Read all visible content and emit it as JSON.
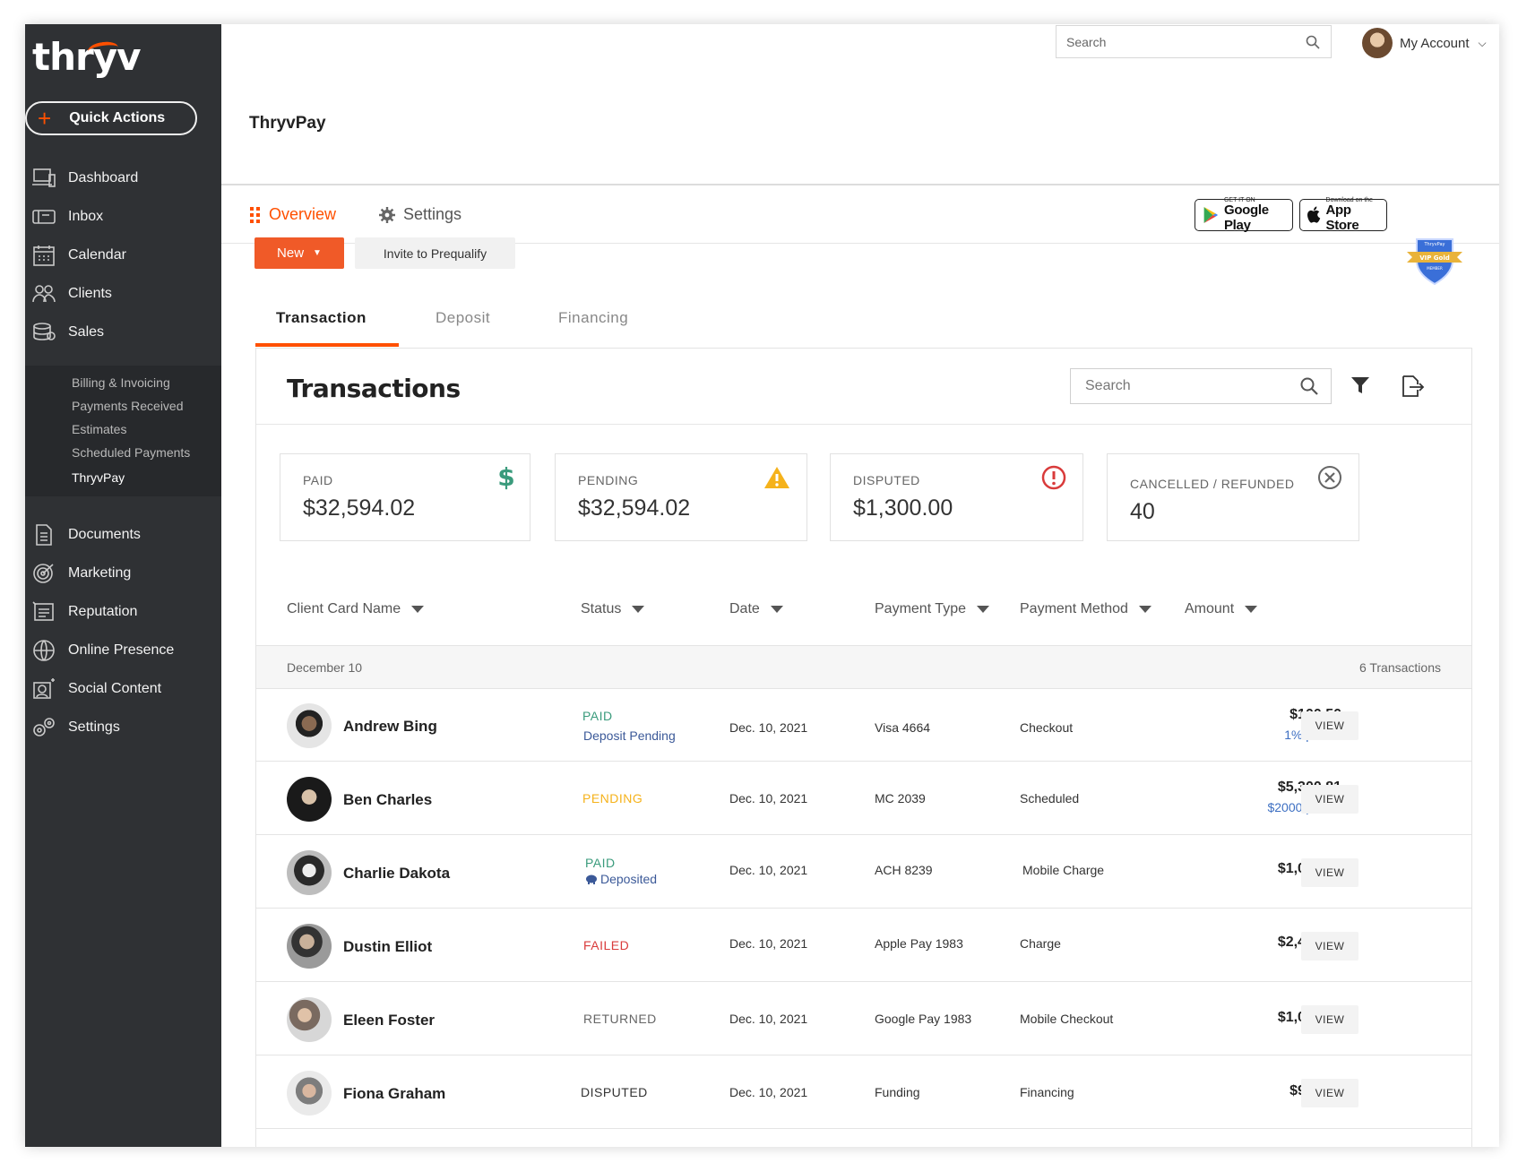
{
  "brand": {
    "logo": "thryv",
    "accent": "#ff5000"
  },
  "sidebar": {
    "quick_actions": "Quick Actions",
    "items": [
      {
        "label": "Dashboard",
        "icon": "dashboard-icon"
      },
      {
        "label": "Inbox",
        "icon": "inbox-icon"
      },
      {
        "label": "Calendar",
        "icon": "calendar-icon"
      },
      {
        "label": "Clients",
        "icon": "clients-icon"
      },
      {
        "label": "Sales",
        "icon": "sales-icon"
      }
    ],
    "sales_sub": [
      "Billing & Invoicing",
      "Payments Received",
      "Estimates",
      "Scheduled Payments",
      "ThryvPay"
    ],
    "items2": [
      {
        "label": "Documents",
        "icon": "documents-icon"
      },
      {
        "label": "Marketing",
        "icon": "marketing-icon"
      },
      {
        "label": "Reputation",
        "icon": "reputation-icon"
      },
      {
        "label": "Online Presence",
        "icon": "globe-icon"
      },
      {
        "label": "Social Content",
        "icon": "social-icon"
      },
      {
        "label": "Settings",
        "icon": "settings-icon"
      }
    ]
  },
  "topbar": {
    "search_placeholder": "Search",
    "account": "My Account"
  },
  "page": {
    "title": "ThryvPay"
  },
  "main_tabs": {
    "overview": "Overview",
    "settings": "Settings"
  },
  "stores": {
    "google_small": "GET IT ON",
    "google_big": "Google Play",
    "apple_small": "Download on the",
    "apple_big": "App Store"
  },
  "actions": {
    "new": "New",
    "invite": "Invite to Prequalify"
  },
  "badge": {
    "top": "ThryvPay",
    "label": "VIP Gold",
    "bottom": "MEMBER"
  },
  "subtabs": [
    "Transaction",
    "Deposit",
    "Financing"
  ],
  "transactions": {
    "title": "Transactions",
    "search_placeholder": "Search",
    "stats": [
      {
        "label": "PAID",
        "value": "$32,594.02",
        "icon": "dollar-icon",
        "color": "#3a9b7c"
      },
      {
        "label": "PENDING",
        "value": "$32,594.02",
        "icon": "warning-icon",
        "color": "#f5b21b"
      },
      {
        "label": "DISPUTED",
        "value": "$1,300.00",
        "icon": "alert-circle-icon",
        "color": "#d93b3b"
      },
      {
        "label": "CANCELLED / REFUNDED",
        "value": "40",
        "icon": "x-circle-icon",
        "color": "#666666"
      }
    ],
    "columns": [
      "Client Card Name",
      "Status",
      "Date",
      "Payment Type",
      "Payment Method",
      "Amount"
    ],
    "group": {
      "date": "December 10",
      "count": "6 Transactions"
    },
    "rows": [
      {
        "name": "Andrew Bing",
        "status": "PAID",
        "status_color": "#3a9b7c",
        "status2": "Deposit Pending",
        "date": "Dec. 10, 2021",
        "type": "Visa 4664",
        "method": "Checkout",
        "amount": "$100.50",
        "promo": "1% promo",
        "view": "VIEW"
      },
      {
        "name": "Ben Charles",
        "status": "PENDING",
        "status_color": "#f5b21b",
        "status2": "",
        "date": "Dec. 10, 2021",
        "type": "MC 2039",
        "method": "Scheduled",
        "amount": "$5,300.81",
        "promo": "$2000 promo",
        "view": "VIEW"
      },
      {
        "name": "Charlie Dakota",
        "status": "PAID",
        "status_color": "#3a9b7c",
        "status2": "Deposited",
        "date": "Dec. 10, 2021",
        "type": "ACH 8239",
        "method": "Mobile Charge",
        "amount": "$1,000.00",
        "promo": "",
        "view": "VIEW"
      },
      {
        "name": "Dustin Elliot",
        "status": "FAILED",
        "status_color": "#d93b3b",
        "status2": "",
        "date": "Dec. 10, 2021",
        "type": "Apple Pay 1983",
        "method": "Charge",
        "amount": "$2,458.00",
        "promo": "",
        "view": "VIEW"
      },
      {
        "name": "Eleen Foster",
        "status": "RETURNED",
        "status_color": "#666666",
        "status2": "",
        "date": "Dec. 10, 2021",
        "type": "Google Pay 1983",
        "method": "Mobile Checkout",
        "amount": "$1,000.00",
        "promo": "",
        "view": "VIEW"
      },
      {
        "name": "Fiona Graham",
        "status": "DISPUTED",
        "status_color": "#333333",
        "status2": "",
        "date": "Dec. 10, 2021",
        "type": "Funding",
        "method": "Financing",
        "amount": "$900.00",
        "promo": "",
        "view": "VIEW"
      }
    ]
  }
}
